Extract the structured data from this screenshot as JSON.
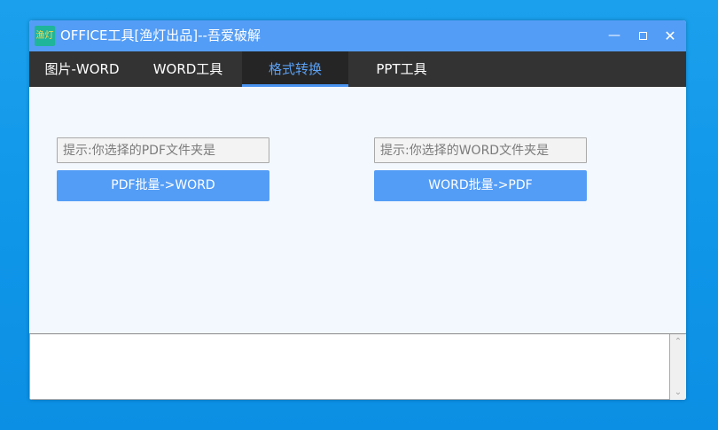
{
  "window": {
    "icon_text": "渔灯",
    "title": "OFFICE工具[渔灯出品]--吾爱破解"
  },
  "tabs": [
    {
      "label": "图片-WORD"
    },
    {
      "label": "WORD工具"
    },
    {
      "label": "格式转换"
    },
    {
      "label": "PPT工具"
    }
  ],
  "converter": {
    "pdf_folder_placeholder": "提示:你选择的PDF文件夹是",
    "pdf_to_word_label": "PDF批量->WORD",
    "word_folder_placeholder": "提示:你选择的WORD文件夹是",
    "word_to_pdf_label": "WORD批量->PDF"
  },
  "colors": {
    "accent": "#549df6",
    "tab_bar": "#333333",
    "active_tab_text": "#5aa0f3"
  }
}
